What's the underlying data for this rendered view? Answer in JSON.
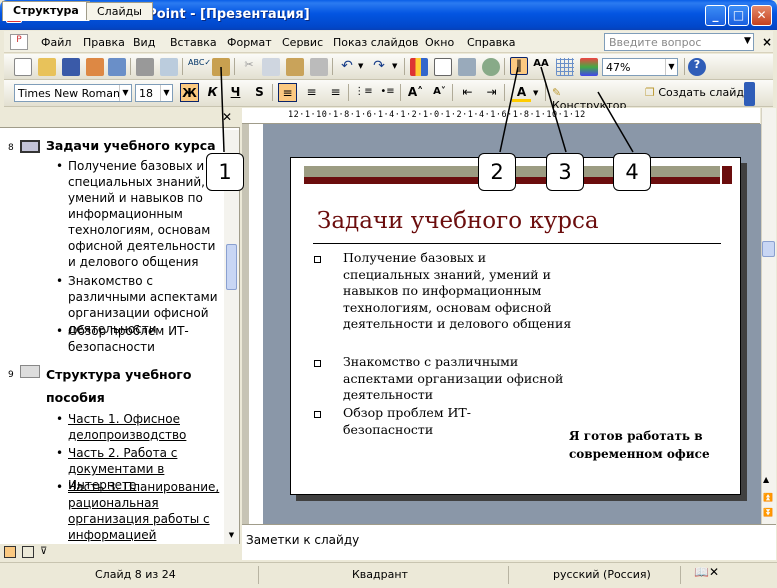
{
  "window": {
    "app_icon": "P",
    "title": "Microsoft PowerPoint - [Презентация]"
  },
  "menu": {
    "items": [
      "Файл",
      "Правка",
      "Вид",
      "Вставка",
      "Формат",
      "Сервис",
      "Показ слайдов",
      "Окно",
      "Справка"
    ],
    "help_placeholder": "Введите вопрос"
  },
  "toolbar_standard": {
    "zoom": "47%"
  },
  "toolbar_format": {
    "font": "Times New Roman",
    "size": "18",
    "bold": "Ж",
    "italic": "К",
    "underline": "Ч",
    "shadow": "S",
    "designer": "Конструктор",
    "new_slide": "Создать слайд"
  },
  "tabs": {
    "outline": "Структура",
    "slides": "Слайды"
  },
  "outline": {
    "slide8": {
      "num": "8",
      "title": "Задачи учебного курса",
      "bullets": [
        "Получение базовых и специальных знаний, умений и навыков по информационным технологиям, основам офисной деятельности и делового общения",
        "Знакомство с различными аспектами организации офисной деятельности",
        "Обзор проблем ИТ-безопасности"
      ]
    },
    "slide9": {
      "num": "9",
      "title": "Структура учебного пособия",
      "links": [
        "Часть 1. Офисное делопроизводство",
        "Часть 2. Работа с документами в Интернете",
        "Часть 3. Планирование, рациональная организация работы с информацией"
      ]
    }
  },
  "slide": {
    "title": "Задачи учебного курса",
    "bullets": [
      "Получение базовых и специальных знаний, умений и навыков по информационным технологиям, основам офисной деятельности и делового общения",
      "Знакомство с различными аспектами организации офисной деятельности",
      "Обзор проблем ИТ-безопасности"
    ],
    "tagline": "Я готов работать в современном офисе"
  },
  "notes": {
    "placeholder": "Заметки к слайду"
  },
  "status": {
    "slide": "Слайд 8 из 24",
    "design": "Квадрант",
    "language": "русский (Россия)"
  },
  "callouts": [
    "1",
    "2",
    "3",
    "4"
  ],
  "colors": {
    "title_bar": "#0355e2",
    "accent_dark_red": "#6b0d0d",
    "slide_bg": "#8a97a8"
  }
}
